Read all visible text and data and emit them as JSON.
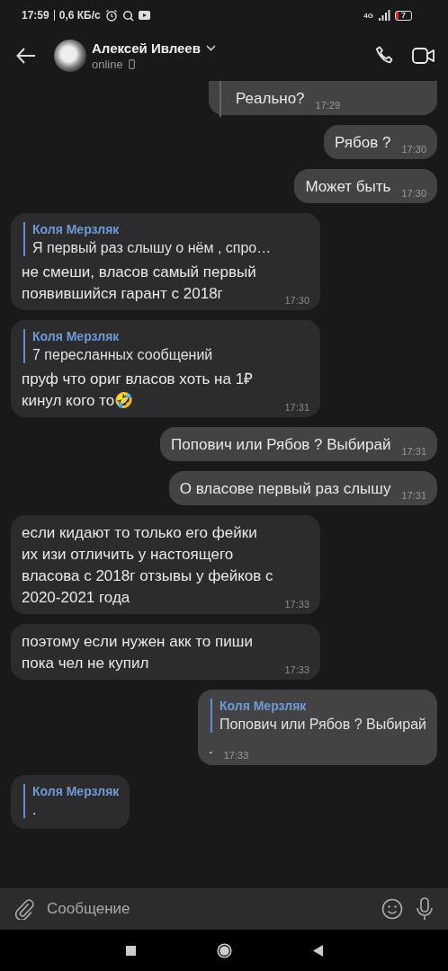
{
  "status_bar": {
    "time": "17:59",
    "speed": "0,6 КБ/с",
    "network": "4G",
    "battery": "7"
  },
  "header": {
    "name": "Алексей Ивлеев",
    "status": "online"
  },
  "messages": [
    {
      "kind": "outgoing",
      "quote_cut": true,
      "text": "Реально?",
      "time": "17:29"
    },
    {
      "kind": "outgoing",
      "text": "Рябов ?",
      "time": "17:30"
    },
    {
      "kind": "outgoing",
      "text": "Может быть",
      "time": "17:30"
    },
    {
      "kind": "incoming",
      "reply": {
        "name": "Коля Мерзляк",
        "text": "Я первый раз слышу о нём , спро…"
      },
      "text": "не смеши, власов самый первый появившийся гарант с 2018г",
      "time": "17:30"
    },
    {
      "kind": "incoming",
      "reply": {
        "name": "Коля Мерзляк",
        "text": "7 пересланных сообщений"
      },
      "text": "пруф что ориг власов хоть на 1₽ кинул кого то🤣",
      "time": "17:31"
    },
    {
      "kind": "outgoing",
      "text": "Попович или Рябов  ? Выбирай",
      "time": "17:31"
    },
    {
      "kind": "outgoing",
      "text": "О власове первый раз слышу",
      "time": "17:31"
    },
    {
      "kind": "incoming",
      "text": "если кидают то только его фейки их изи отличить у настоящего власова с 2018г отзывы у фейков с 2020-2021 года",
      "time": "17:33"
    },
    {
      "kind": "incoming",
      "text": "поэтому если нужен акк то пиши пока чел не купил",
      "time": "17:33"
    },
    {
      "kind": "outgoing",
      "reply": {
        "name": "Коля Мерзляк",
        "text": "Попович или Рябов  ? Выбирай"
      },
      "text": ".",
      "time": "17:33"
    },
    {
      "kind": "incoming",
      "reply": {
        "name": "Коля Мерзляк",
        "text": "."
      }
    }
  ],
  "composer": {
    "placeholder": "Сообщение"
  }
}
